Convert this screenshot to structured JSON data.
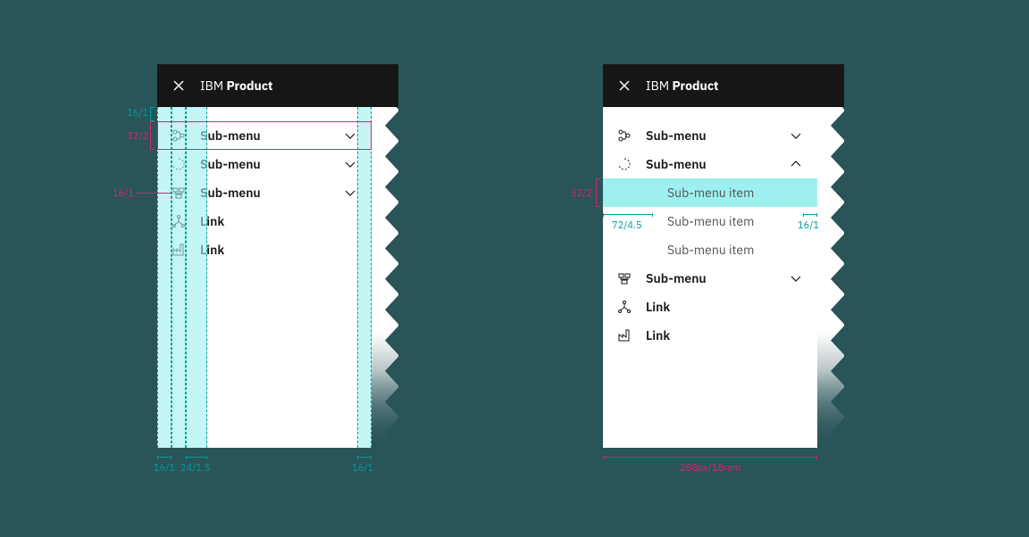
{
  "header": {
    "prefix": "IBM",
    "product": "Product"
  },
  "left": {
    "items": [
      {
        "label": "Sub-menu",
        "icon": "flow",
        "submenu": true
      },
      {
        "label": "Sub-menu",
        "icon": "loading",
        "submenu": true
      },
      {
        "label": "Sub-menu",
        "icon": "data",
        "submenu": true
      },
      {
        "label": "Link",
        "icon": "nodes",
        "submenu": false
      },
      {
        "label": "Link",
        "icon": "factory",
        "submenu": false
      }
    ],
    "specs": {
      "top_pad": "16/1",
      "row_h": "32/2",
      "icon_left": "16/1",
      "icon_gap_left": "16/1",
      "icon_gap_right": "24/1.5",
      "chev_right": "16/1"
    }
  },
  "right": {
    "items": [
      {
        "label": "Sub-menu",
        "icon": "flow",
        "submenu": true,
        "expanded": false
      },
      {
        "label": "Sub-menu",
        "icon": "loading",
        "submenu": true,
        "expanded": true,
        "children": [
          "Sub-menu item",
          "Sub-menu item",
          "Sub-menu item"
        ]
      },
      {
        "label": "Sub-menu",
        "icon": "data",
        "submenu": true,
        "expanded": false
      },
      {
        "label": "Link",
        "icon": "nodes",
        "submenu": false
      },
      {
        "label": "Link",
        "icon": "factory",
        "submenu": false
      }
    ],
    "specs": {
      "item_h": "32/2",
      "indent": "72/4.5",
      "right_pad": "16/1",
      "panel_w": "288px/18rem"
    }
  }
}
